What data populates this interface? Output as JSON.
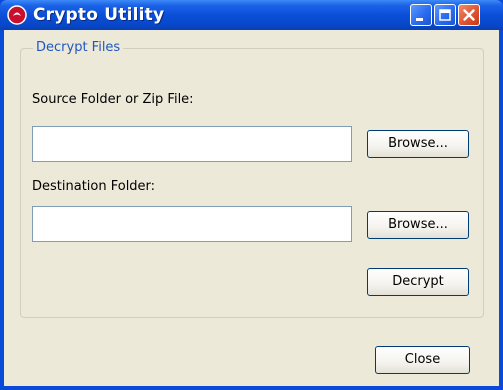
{
  "window": {
    "title": "Crypto Utility"
  },
  "titlebar_buttons": {
    "minimize": "minimize-icon",
    "maximize": "maximize-icon",
    "close": "close-icon"
  },
  "group": {
    "legend": "Decrypt Files"
  },
  "source": {
    "label": "Source Folder or Zip File:",
    "value": "",
    "browse_label": "Browse..."
  },
  "destination": {
    "label": "Destination Folder:",
    "value": "",
    "browse_label": "Browse..."
  },
  "actions": {
    "decrypt_label": "Decrypt",
    "close_label": "Close"
  },
  "colors": {
    "titlebar_blue": "#0b4fd8",
    "client_bg": "#ece9d8",
    "legend_blue": "#1f56c6",
    "close_red": "#e0552f"
  }
}
